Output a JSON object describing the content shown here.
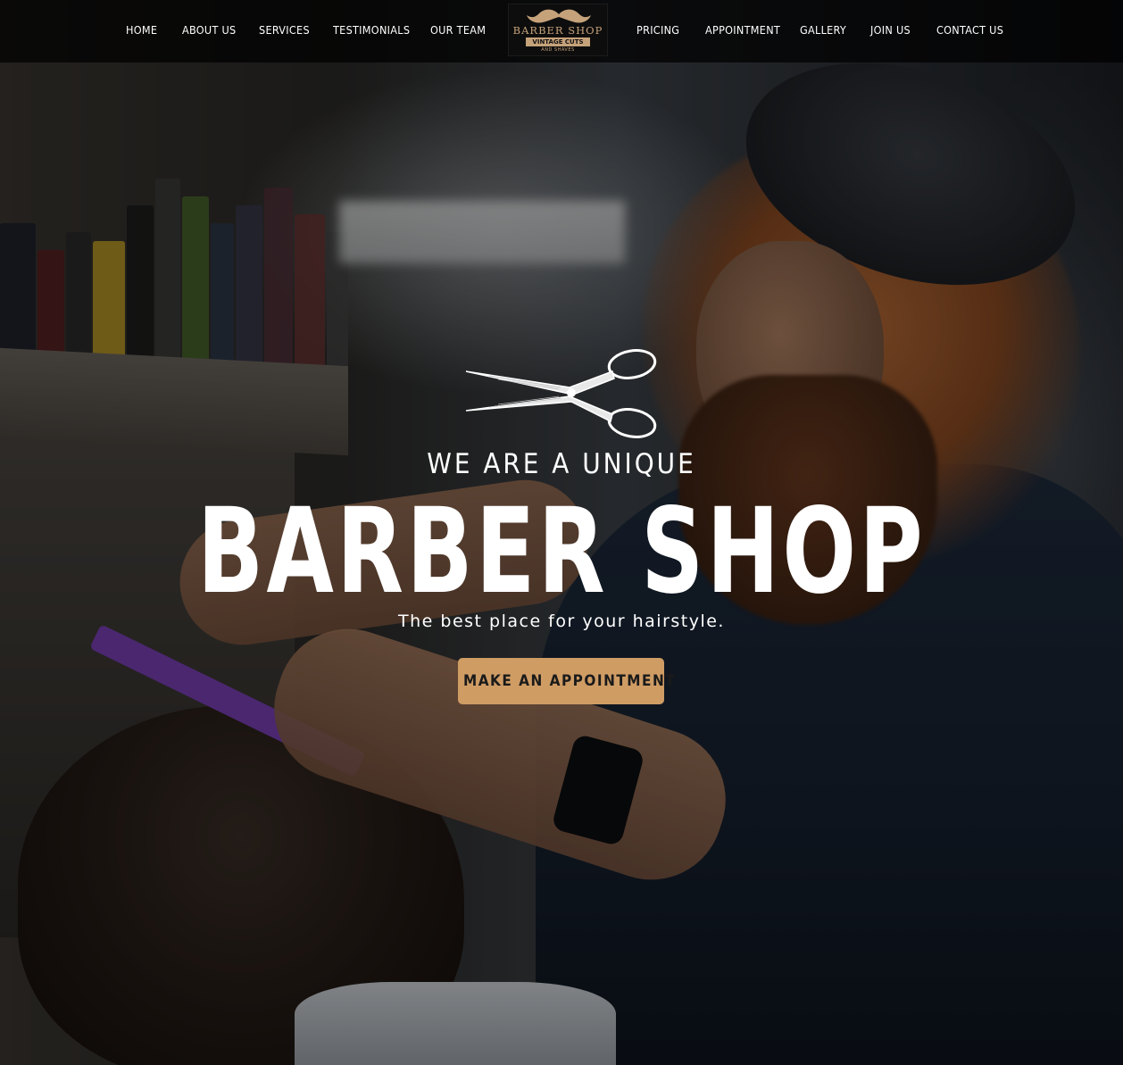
{
  "nav": {
    "items": [
      {
        "label": "HOME"
      },
      {
        "label": "ABOUT US"
      },
      {
        "label": "SERVICES"
      },
      {
        "label": "TESTIMONIALS"
      },
      {
        "label": "OUR TEAM"
      },
      {
        "label": "PRICING"
      },
      {
        "label": "APPOINTMENT"
      },
      {
        "label": "GALLERY"
      },
      {
        "label": "JOIN US"
      },
      {
        "label": "CONTACT US"
      }
    ],
    "logo": {
      "title": "BARBER SHOP",
      "ribbon": "VINTAGE CUTS",
      "subtitle": "AND SHAVES",
      "icon": "mustache-icon"
    }
  },
  "hero": {
    "icon": "scissors-icon",
    "tagline": "WE ARE A UNIQUE",
    "title": "BARBER SHOP",
    "subtitle": "The best place for your hairstyle.",
    "cta_label": "MAKE AN APPOINTMENT"
  },
  "colors": {
    "accent": "#cf9c64",
    "logo_gold": "#c6a27a",
    "nav_background": "#000000",
    "text": "#ffffff"
  }
}
